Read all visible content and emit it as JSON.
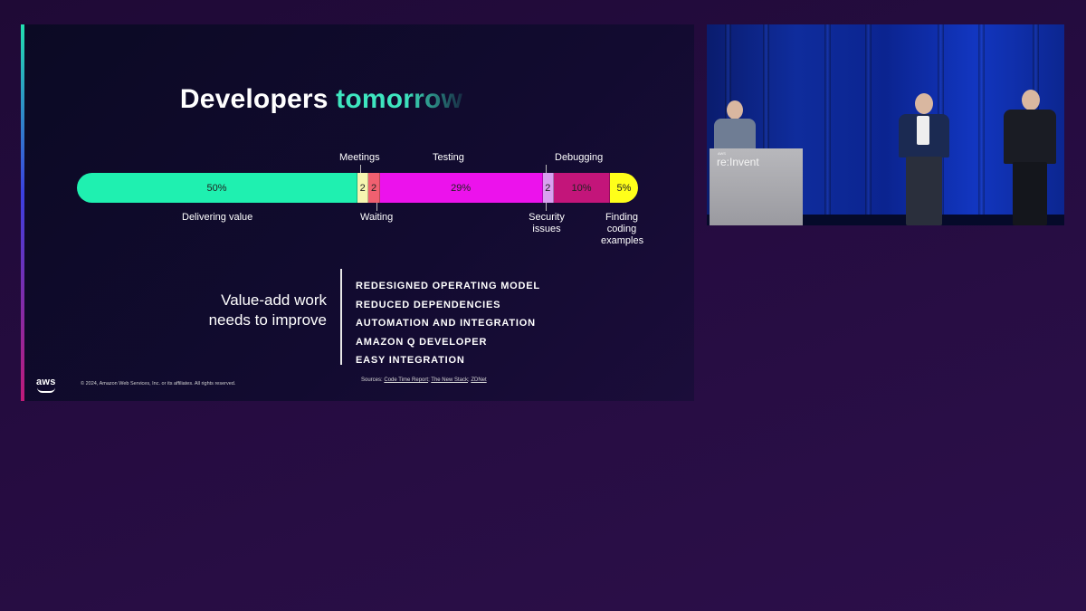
{
  "slide": {
    "title_main": "Developers",
    "title_highlight": "tomorrow",
    "bar_segments": [
      {
        "label": "50%",
        "value": 50,
        "color": "#1ff0b0"
      },
      {
        "label": "2",
        "value": 2,
        "color": "#f6f6b0"
      },
      {
        "label": "2",
        "value": 2,
        "color": "#f06070"
      },
      {
        "label": "29%",
        "value": 29,
        "color": "#ec12ec"
      },
      {
        "label": "2",
        "value": 2,
        "color": "#d8a0f0"
      },
      {
        "label": "10%",
        "value": 10,
        "color": "#c3157a"
      },
      {
        "label": "5%",
        "value": 5,
        "color": "#ffff1a"
      }
    ],
    "labels_above": {
      "meetings": "Meetings",
      "testing": "Testing",
      "debugging": "Debugging"
    },
    "labels_below": {
      "delivering_value": "Delivering value",
      "waiting": "Waiting",
      "security_line1": "Security",
      "security_line2": "issues",
      "finding_line1": "Finding",
      "finding_line2": "coding",
      "finding_line3": "examples"
    },
    "left_heading_line1": "Value-add work",
    "left_heading_line2": "needs to improve",
    "points": [
      "REDESIGNED OPERATING MODEL",
      "REDUCED DEPENDENCIES",
      "AUTOMATION AND INTEGRATION",
      "AMAZON Q DEVELOPER",
      "EASY INTEGRATION"
    ],
    "logo_text": "aws",
    "copyright": "© 2024, Amazon Web Services, Inc. or its affiliates. All rights reserved.",
    "sources_prefix": "Sources:",
    "source_links": [
      "Code Time Report",
      "The New Stack",
      "ZDNet"
    ]
  },
  "video": {
    "podium_brand_small": "AWS",
    "podium_brand": "re:Invent"
  }
}
